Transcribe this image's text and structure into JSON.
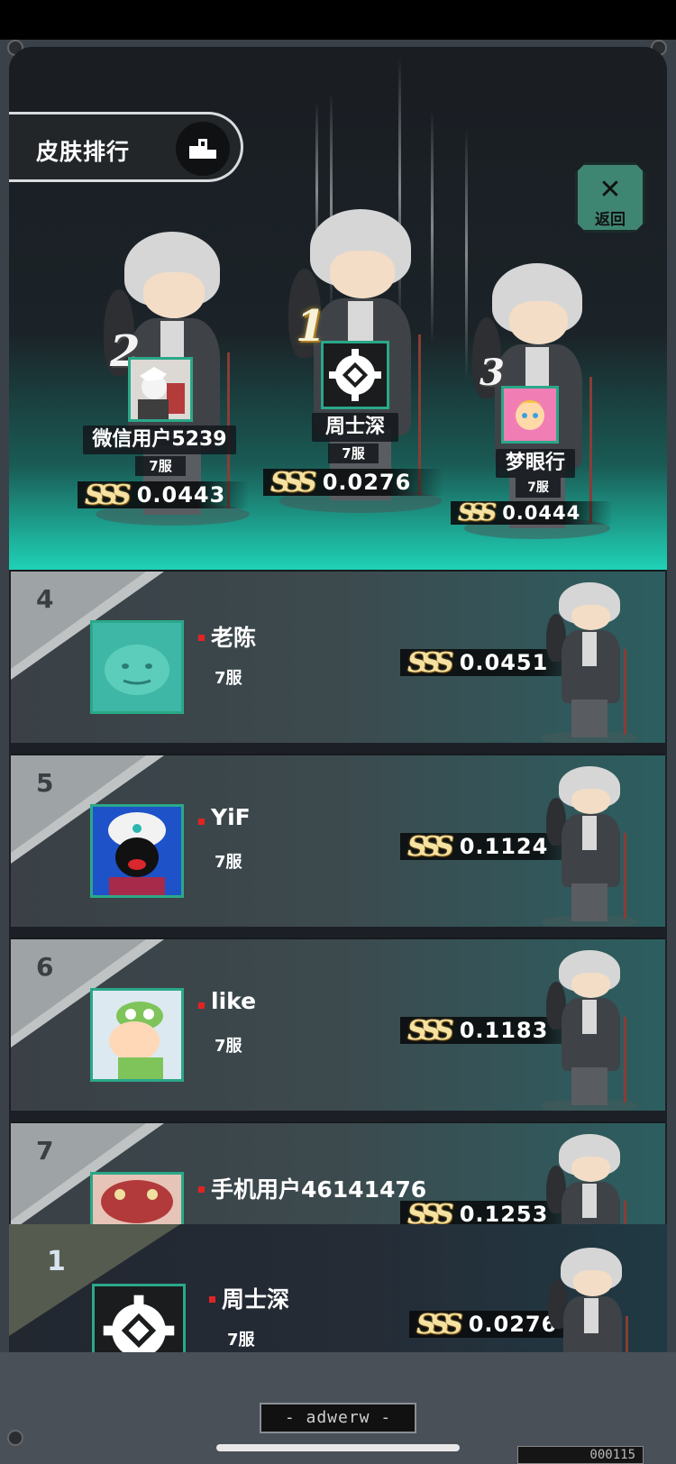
{
  "header": {
    "title": "皮肤排行",
    "back_label": "返回",
    "back_icon": "close-x-icon"
  },
  "currency_mark": "SSS",
  "podium": [
    {
      "rank": "2",
      "name": "微信用户5239",
      "server": "7服",
      "score": "0.0443"
    },
    {
      "rank": "1",
      "name": "周士深",
      "server": "7服",
      "score": "0.0276"
    },
    {
      "rank": "3",
      "name": "梦眼行",
      "server": "7服",
      "score": "0.0444"
    }
  ],
  "list": [
    {
      "rank": "4",
      "name": "老陈",
      "server": "7服",
      "score": "0.0451"
    },
    {
      "rank": "5",
      "name": "YiF",
      "server": "7服",
      "score": "0.1124"
    },
    {
      "rank": "6",
      "name": "like",
      "server": "7服",
      "score": "0.1183"
    },
    {
      "rank": "7",
      "name": "手机用户46141476",
      "server": "",
      "score": "0.1253"
    }
  ],
  "my_rank": {
    "rank": "1",
    "name": "周士深",
    "server": "7服",
    "score": "0.0276"
  },
  "footer": {
    "slot_label": "- adwerw -",
    "counter": "000115"
  },
  "colors": {
    "accent_teal": "#1fd2b6",
    "avatar_border": "#2aa889",
    "dot_red": "#e02424",
    "gold": "#f5e2a2"
  }
}
